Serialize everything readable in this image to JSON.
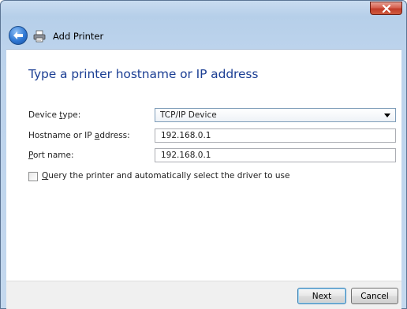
{
  "window": {
    "title": "Add Printer"
  },
  "heading": "Type a printer hostname or IP address",
  "form": {
    "device_type": {
      "label_pre": "Device ",
      "label_key": "t",
      "label_post": "ype:",
      "value": "TCP/IP Device"
    },
    "hostname": {
      "label_pre": "Hostname or IP ",
      "label_key": "a",
      "label_post": "ddress:",
      "value": "192.168.0.1"
    },
    "port": {
      "label_pre": "",
      "label_key": "P",
      "label_post": "ort name:",
      "value": "192.168.0.1"
    },
    "query_driver": {
      "label_pre": "",
      "label_key": "Q",
      "label_post": "uery the printer and automatically select the driver to use",
      "checked": false
    }
  },
  "buttons": {
    "next": "Next",
    "cancel": "Cancel"
  },
  "icons": {
    "close": "close-icon",
    "back": "back-arrow-icon",
    "printer": "printer-icon",
    "dropdown": "chevron-down-icon"
  },
  "colors": {
    "heading": "#1c3f94",
    "close_button": "#c23d2a",
    "back_button": "#2f78d4"
  }
}
